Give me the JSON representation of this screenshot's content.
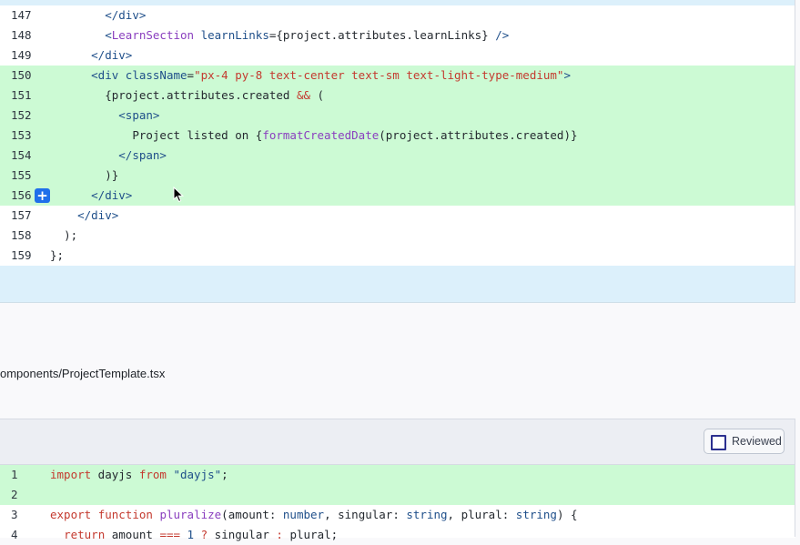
{
  "top_diff": {
    "rows": [
      {
        "line": "147",
        "added": false,
        "indent": "        ",
        "tokens": [
          {
            "c": "tg",
            "t": "</div>"
          }
        ]
      },
      {
        "line": "148",
        "added": false,
        "indent": "        ",
        "tokens": [
          {
            "c": "tg",
            "t": "<"
          },
          {
            "c": "cmp",
            "t": "LearnSection"
          },
          {
            "c": "",
            "t": " "
          },
          {
            "c": "attr",
            "t": "learnLinks"
          },
          {
            "c": "",
            "t": "={project.attributes.learnLinks} "
          },
          {
            "c": "tg",
            "t": "/>"
          }
        ]
      },
      {
        "line": "149",
        "added": false,
        "indent": "      ",
        "tokens": [
          {
            "c": "tg",
            "t": "</div>"
          }
        ]
      },
      {
        "line": "150",
        "added": true,
        "indent": "      ",
        "tokens": [
          {
            "c": "tg",
            "t": "<div"
          },
          {
            "c": "",
            "t": " "
          },
          {
            "c": "attr",
            "t": "className"
          },
          {
            "c": "",
            "t": "="
          },
          {
            "c": "str",
            "t": "\"px-4 py-8 text-center text-sm text-light-type-medium\""
          },
          {
            "c": "tg",
            "t": ">"
          }
        ]
      },
      {
        "line": "151",
        "added": true,
        "indent": "        ",
        "tokens": [
          {
            "c": "",
            "t": "{project.attributes.created "
          },
          {
            "c": "kw",
            "t": "&&"
          },
          {
            "c": "",
            "t": " ("
          }
        ]
      },
      {
        "line": "152",
        "added": true,
        "indent": "          ",
        "tokens": [
          {
            "c": "tg",
            "t": "<span>"
          }
        ]
      },
      {
        "line": "153",
        "added": true,
        "indent": "            ",
        "tokens": [
          {
            "c": "",
            "t": "Project listed on {"
          },
          {
            "c": "fn",
            "t": "formatCreatedDate"
          },
          {
            "c": "",
            "t": "(project.attributes.created)}"
          }
        ]
      },
      {
        "line": "154",
        "added": true,
        "indent": "          ",
        "tokens": [
          {
            "c": "tg",
            "t": "</span>"
          }
        ]
      },
      {
        "line": "155",
        "added": true,
        "indent": "        ",
        "tokens": [
          {
            "c": "",
            "t": ")}"
          }
        ]
      },
      {
        "line": "156",
        "added": true,
        "plus": true,
        "indent": "      ",
        "tokens": [
          {
            "c": "tg",
            "t": "</div>"
          }
        ]
      },
      {
        "line": "157",
        "added": false,
        "indent": "    ",
        "tokens": [
          {
            "c": "tg",
            "t": "</div>"
          }
        ]
      },
      {
        "line": "158",
        "added": false,
        "indent": "  ",
        "tokens": [
          {
            "c": "",
            "t": ");"
          }
        ]
      },
      {
        "line": "159",
        "added": false,
        "indent": "",
        "tokens": [
          {
            "c": "",
            "t": "};"
          }
        ]
      }
    ],
    "plus_symbol": "+"
  },
  "file": {
    "path": "omponents/ProjectTemplate.tsx",
    "reviewed_label": "Reviewed"
  },
  "bottom_diff": {
    "rows": [
      {
        "line": "1",
        "added": true,
        "indent": "",
        "tokens": [
          {
            "c": "kw",
            "t": "import"
          },
          {
            "c": "",
            "t": " dayjs "
          },
          {
            "c": "kw",
            "t": "from"
          },
          {
            "c": "",
            "t": " "
          },
          {
            "c": "typ",
            "t": "\"dayjs\""
          },
          {
            "c": "",
            "t": ";"
          }
        ]
      },
      {
        "line": "2",
        "added": true,
        "indent": "",
        "tokens": []
      },
      {
        "line": "3",
        "added": false,
        "indent": "",
        "tokens": [
          {
            "c": "kw",
            "t": "export"
          },
          {
            "c": "",
            "t": " "
          },
          {
            "c": "kw",
            "t": "function"
          },
          {
            "c": "",
            "t": " "
          },
          {
            "c": "fn",
            "t": "pluralize"
          },
          {
            "c": "",
            "t": "(amount: "
          },
          {
            "c": "typ",
            "t": "number"
          },
          {
            "c": "",
            "t": ", singular: "
          },
          {
            "c": "typ",
            "t": "string"
          },
          {
            "c": "",
            "t": ", plural: "
          },
          {
            "c": "typ",
            "t": "string"
          },
          {
            "c": "",
            "t": ") {"
          }
        ]
      },
      {
        "line": "4",
        "added": false,
        "indent": "  ",
        "tokens": [
          {
            "c": "kw",
            "t": "return"
          },
          {
            "c": "",
            "t": " amount "
          },
          {
            "c": "kw",
            "t": "==="
          },
          {
            "c": "",
            "t": " "
          },
          {
            "c": "typ",
            "t": "1"
          },
          {
            "c": "",
            "t": " "
          },
          {
            "c": "kw",
            "t": "?"
          },
          {
            "c": "",
            "t": " singular "
          },
          {
            "c": "kw",
            "t": ":"
          },
          {
            "c": "",
            "t": " plural;"
          }
        ]
      }
    ]
  },
  "colors": {
    "added_bg": "#ccfad4",
    "context_band": "#dcf0fb",
    "plus_button": "#1f6fea"
  }
}
